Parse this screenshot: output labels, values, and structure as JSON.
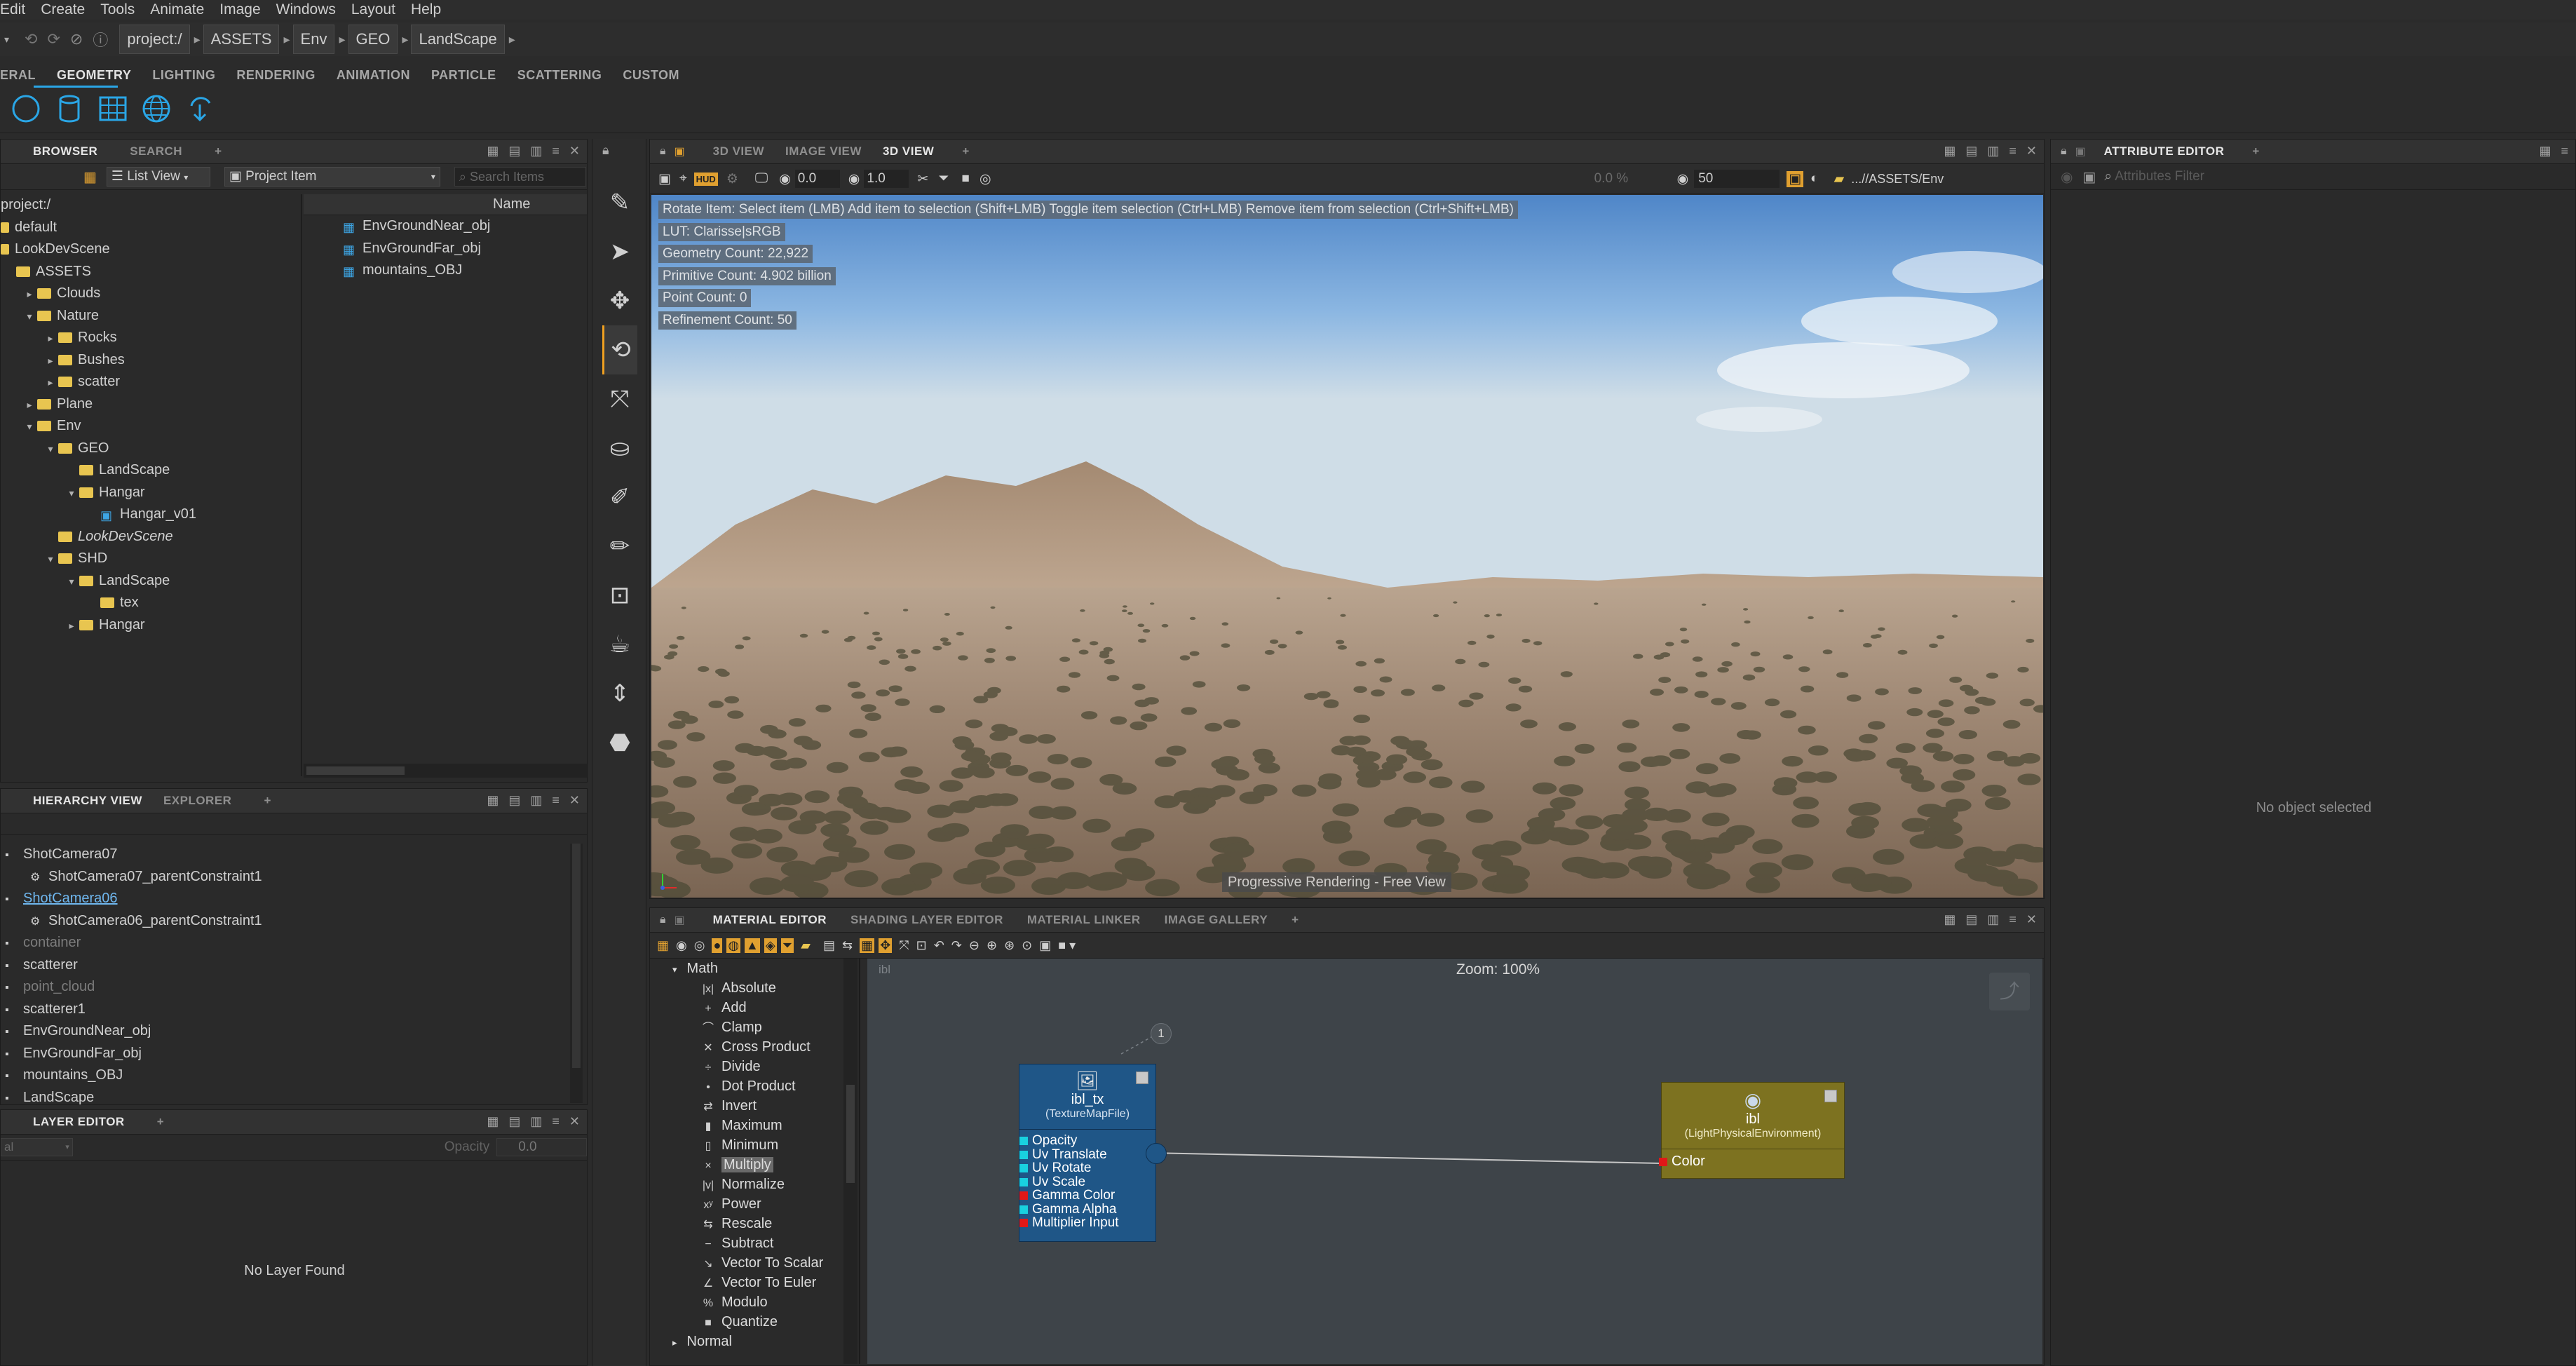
{
  "menubar": {
    "items": [
      "Edit",
      "Create",
      "Tools",
      "Animate",
      "Image",
      "Windows",
      "Layout",
      "Help"
    ]
  },
  "pathbar": {
    "crumbs": [
      "project:/",
      "ASSETS",
      "Env",
      "GEO",
      "LandScape"
    ]
  },
  "shelf": {
    "tabs": [
      "ERAL",
      "GEOMETRY",
      "LIGHTING",
      "RENDERING",
      "ANIMATION",
      "PARTICLE",
      "SCATTERING",
      "CUSTOM"
    ],
    "active_tab": "GEOMETRY",
    "icons": [
      "sphere-icon",
      "cylinder-icon",
      "grid-icon",
      "globe-icon",
      "import-icon"
    ]
  },
  "browser": {
    "tabs": [
      "BROWSER",
      "SEARCH",
      "+"
    ],
    "view_mode": "List View",
    "filter": "Project Item",
    "search_placeholder": "Search Items",
    "column_name": "Name",
    "tree": [
      {
        "label": "project:/",
        "depth": 0,
        "type": "root"
      },
      {
        "label": "default",
        "depth": 0,
        "type": "ctx"
      },
      {
        "label": "LookDevScene",
        "depth": 0,
        "type": "ctx"
      },
      {
        "label": "ASSETS",
        "depth": 0,
        "type": "folder"
      },
      {
        "label": "Clouds",
        "depth": 1,
        "type": "folder",
        "arrow": "▸"
      },
      {
        "label": "Nature",
        "depth": 1,
        "type": "folder",
        "arrow": "▾"
      },
      {
        "label": "Rocks",
        "depth": 2,
        "type": "folder",
        "arrow": "▸"
      },
      {
        "label": "Bushes",
        "depth": 2,
        "type": "folder",
        "arrow": "▸"
      },
      {
        "label": "scatter",
        "depth": 2,
        "type": "folder",
        "arrow": "▸"
      },
      {
        "label": "Plane",
        "depth": 1,
        "type": "folder",
        "arrow": "▸"
      },
      {
        "label": "Env",
        "depth": 1,
        "type": "folder",
        "arrow": "▾"
      },
      {
        "label": "GEO",
        "depth": 2,
        "type": "folder",
        "arrow": "▾"
      },
      {
        "label": "LandScape",
        "depth": 3,
        "type": "folder"
      },
      {
        "label": "Hangar",
        "depth": 3,
        "type": "folder",
        "arrow": "▾"
      },
      {
        "label": "Hangar_v01",
        "depth": 4,
        "type": "item"
      },
      {
        "label": "LookDevScene",
        "depth": 2,
        "type": "folder-italic"
      },
      {
        "label": "SHD",
        "depth": 2,
        "type": "folder",
        "arrow": "▾"
      },
      {
        "label": "LandScape",
        "depth": 3,
        "type": "folder",
        "arrow": "▾"
      },
      {
        "label": "tex",
        "depth": 4,
        "type": "folder"
      },
      {
        "label": "Hangar",
        "depth": 3,
        "type": "folder",
        "arrow": "▸"
      }
    ],
    "items": [
      "EnvGroundNear_obj",
      "EnvGroundFar_obj",
      "mountains_OBJ"
    ]
  },
  "hierarchy": {
    "tabs": [
      "HIERARCHY VIEW",
      "EXPLORER",
      "+"
    ],
    "items": [
      {
        "label": "ShotCamera07",
        "depth": 0,
        "style": "normal"
      },
      {
        "label": "ShotCamera07_parentConstraint1",
        "depth": 1,
        "style": "normal"
      },
      {
        "label": "ShotCamera06",
        "depth": 0,
        "style": "link"
      },
      {
        "label": "ShotCamera06_parentConstraint1",
        "depth": 1,
        "style": "normal"
      },
      {
        "label": "container",
        "depth": 0,
        "style": "dim"
      },
      {
        "label": "scatterer",
        "depth": 0,
        "style": "normal"
      },
      {
        "label": "point_cloud",
        "depth": 0,
        "style": "dim"
      },
      {
        "label": "scatterer1",
        "depth": 0,
        "style": "normal"
      },
      {
        "label": "EnvGroundNear_obj",
        "depth": 0,
        "style": "normal"
      },
      {
        "label": "EnvGroundFar_obj",
        "depth": 0,
        "style": "normal"
      },
      {
        "label": "mountains_OBJ",
        "depth": 0,
        "style": "normal"
      },
      {
        "label": "LandScape",
        "depth": 0,
        "style": "normal"
      }
    ]
  },
  "layer_editor": {
    "tabs": [
      "LAYER EDITOR",
      "+"
    ],
    "opacity_label": "Opacity",
    "opacity_value": "0.0",
    "empty_text": "No Layer Found",
    "mode_value": "al"
  },
  "viewport": {
    "tabs": [
      "3D VIEW",
      "IMAGE VIEW",
      "3D VIEW",
      "+"
    ],
    "active_tab_index": 2,
    "field_a": "0.0",
    "field_b": "1.0",
    "percent": "0.0 %",
    "samples": "50",
    "path": "...//ASSETS/Env",
    "overlay": [
      "Rotate Item: Select item (LMB)  Add item to selection (Shift+LMB)  Toggle item selection (Ctrl+LMB)  Remove item from selection (Ctrl+Shift+LMB)",
      "LUT: Clarisse|sRGB",
      "Geometry Count: 22,922",
      "Primitive Count: 4.902 billion",
      "Point Count: 0",
      "Refinement Count: 50"
    ],
    "status": "Progressive Rendering - Free View"
  },
  "attribute_editor": {
    "tabs": [
      "ATTRIBUTE EDITOR",
      "+"
    ],
    "filter_placeholder": "Attributes Filter",
    "empty_text": "No object selected"
  },
  "material_editor": {
    "tabs": [
      "MATERIAL EDITOR",
      "SHADING LAYER EDITOR",
      "MATERIAL LINKER",
      "IMAGE GALLERY",
      "+"
    ],
    "zoom_label": "Zoom: 100%",
    "canvas_tag": "ibl",
    "palette_group": "Math",
    "palette_items": [
      {
        "label": "Absolute",
        "icon": "|x|"
      },
      {
        "label": "Add",
        "icon": "+"
      },
      {
        "label": "Clamp",
        "icon": "⌒"
      },
      {
        "label": "Cross Product",
        "icon": "✕"
      },
      {
        "label": "Divide",
        "icon": "÷"
      },
      {
        "label": "Dot Product",
        "icon": "•"
      },
      {
        "label": "Invert",
        "icon": "⇄"
      },
      {
        "label": "Maximum",
        "icon": "▮"
      },
      {
        "label": "Minimum",
        "icon": "▯"
      },
      {
        "label": "Multiply",
        "icon": "×"
      },
      {
        "label": "Normalize",
        "icon": "|v|"
      },
      {
        "label": "Power",
        "icon": "xʸ"
      },
      {
        "label": "Rescale",
        "icon": "⇆"
      },
      {
        "label": "Subtract",
        "icon": "−"
      },
      {
        "label": "Vector To Scalar",
        "icon": "↘"
      },
      {
        "label": "Vector To Euler",
        "icon": "∠"
      },
      {
        "label": "Modulo",
        "icon": "%"
      },
      {
        "label": "Quantize",
        "icon": "■"
      }
    ],
    "palette_selected": "Multiply",
    "palette_next_group": "Normal",
    "node_tx": {
      "name": "ibl_tx",
      "type": "(TextureMapFile)",
      "badge": "1",
      "ports": [
        {
          "label": "Opacity",
          "color": "#19d0e0"
        },
        {
          "label": "Uv Translate",
          "color": "#19d0e0"
        },
        {
          "label": "Uv Rotate",
          "color": "#19d0e0"
        },
        {
          "label": "Uv Scale",
          "color": "#19d0e0"
        },
        {
          "label": "Gamma Color",
          "color": "#e01818"
        },
        {
          "label": "Gamma Alpha",
          "color": "#19d0e0"
        },
        {
          "label": "Multiplier Input",
          "color": "#e01818"
        }
      ]
    },
    "node_ibl": {
      "name": "ibl",
      "type": "(LightPhysicalEnvironment)",
      "port": "Color"
    }
  },
  "colors": {
    "accent": "#2aa6e6",
    "node_tx_bg": "#1f5687",
    "node_ibl_bg": "#7d7220",
    "folder": "#e8c550"
  }
}
